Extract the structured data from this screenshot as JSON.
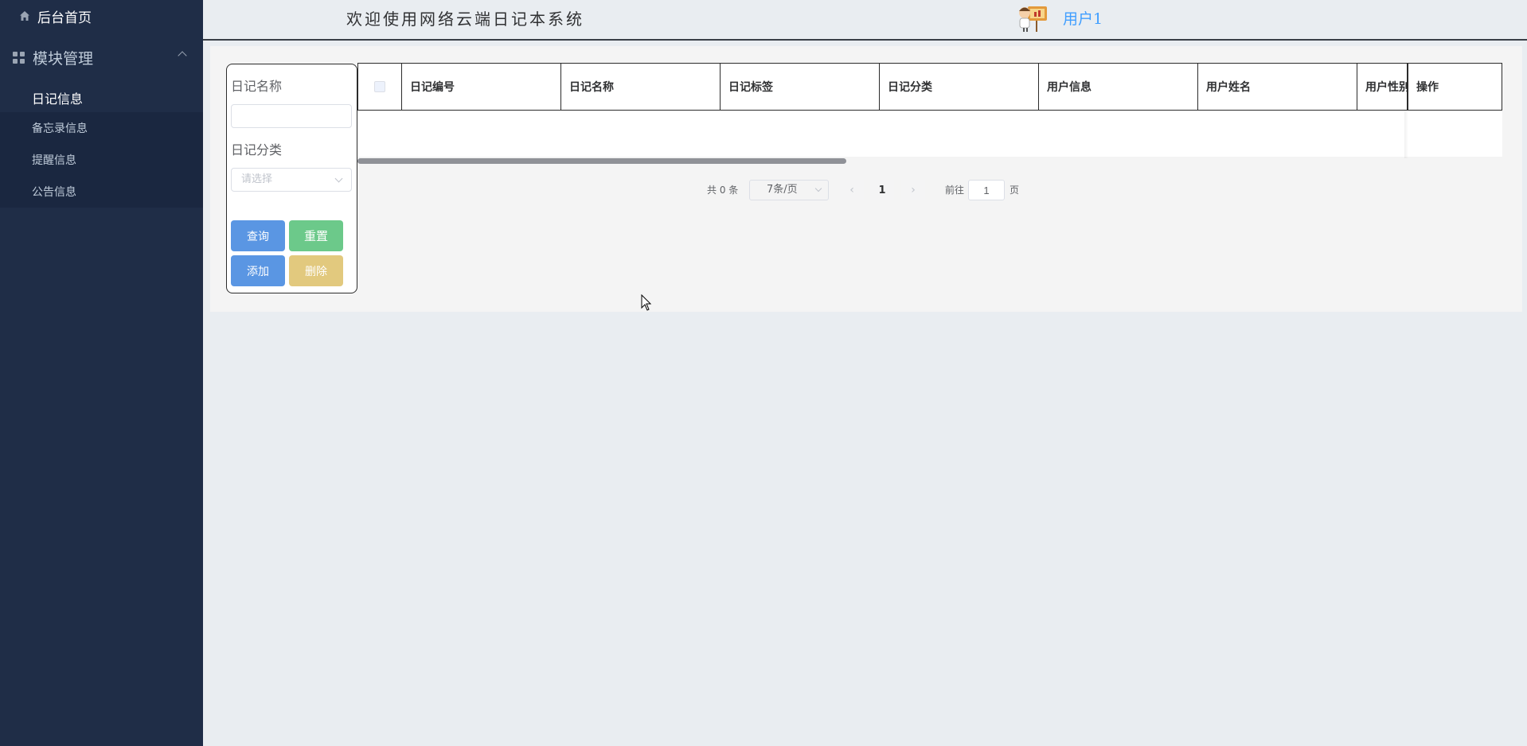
{
  "sidebar": {
    "home_label": "后台首页",
    "module_label": "模块管理",
    "items": [
      {
        "label": "日记信息"
      },
      {
        "label": "备忘录信息"
      },
      {
        "label": "提醒信息"
      },
      {
        "label": "公告信息"
      }
    ]
  },
  "header": {
    "title": "欢迎使用网络云端日记本系统",
    "username": "用户1"
  },
  "filter": {
    "name_label": "日记名称",
    "name_value": "",
    "category_label": "日记分类",
    "category_placeholder": "请选择",
    "query_button": "查询",
    "reset_button": "重置",
    "add_button": "添加",
    "delete_button": "删除"
  },
  "table": {
    "columns": [
      "日记编号",
      "日记名称",
      "日记标签",
      "日记分类",
      "用户信息",
      "用户姓名",
      "用户性别",
      "操作"
    ],
    "rows": []
  },
  "pagination": {
    "total_text": "共 0 条",
    "page_size": "7条/页",
    "current_page": "1",
    "goto_prefix": "前往",
    "goto_value": "1",
    "goto_suffix": "页"
  },
  "colors": {
    "sidebar_bg": "#1f2d47",
    "accent_blue": "#409eff",
    "query_button": "#5a96e3",
    "reset_button": "#6cc98a",
    "delete_button": "#e2c97e"
  }
}
